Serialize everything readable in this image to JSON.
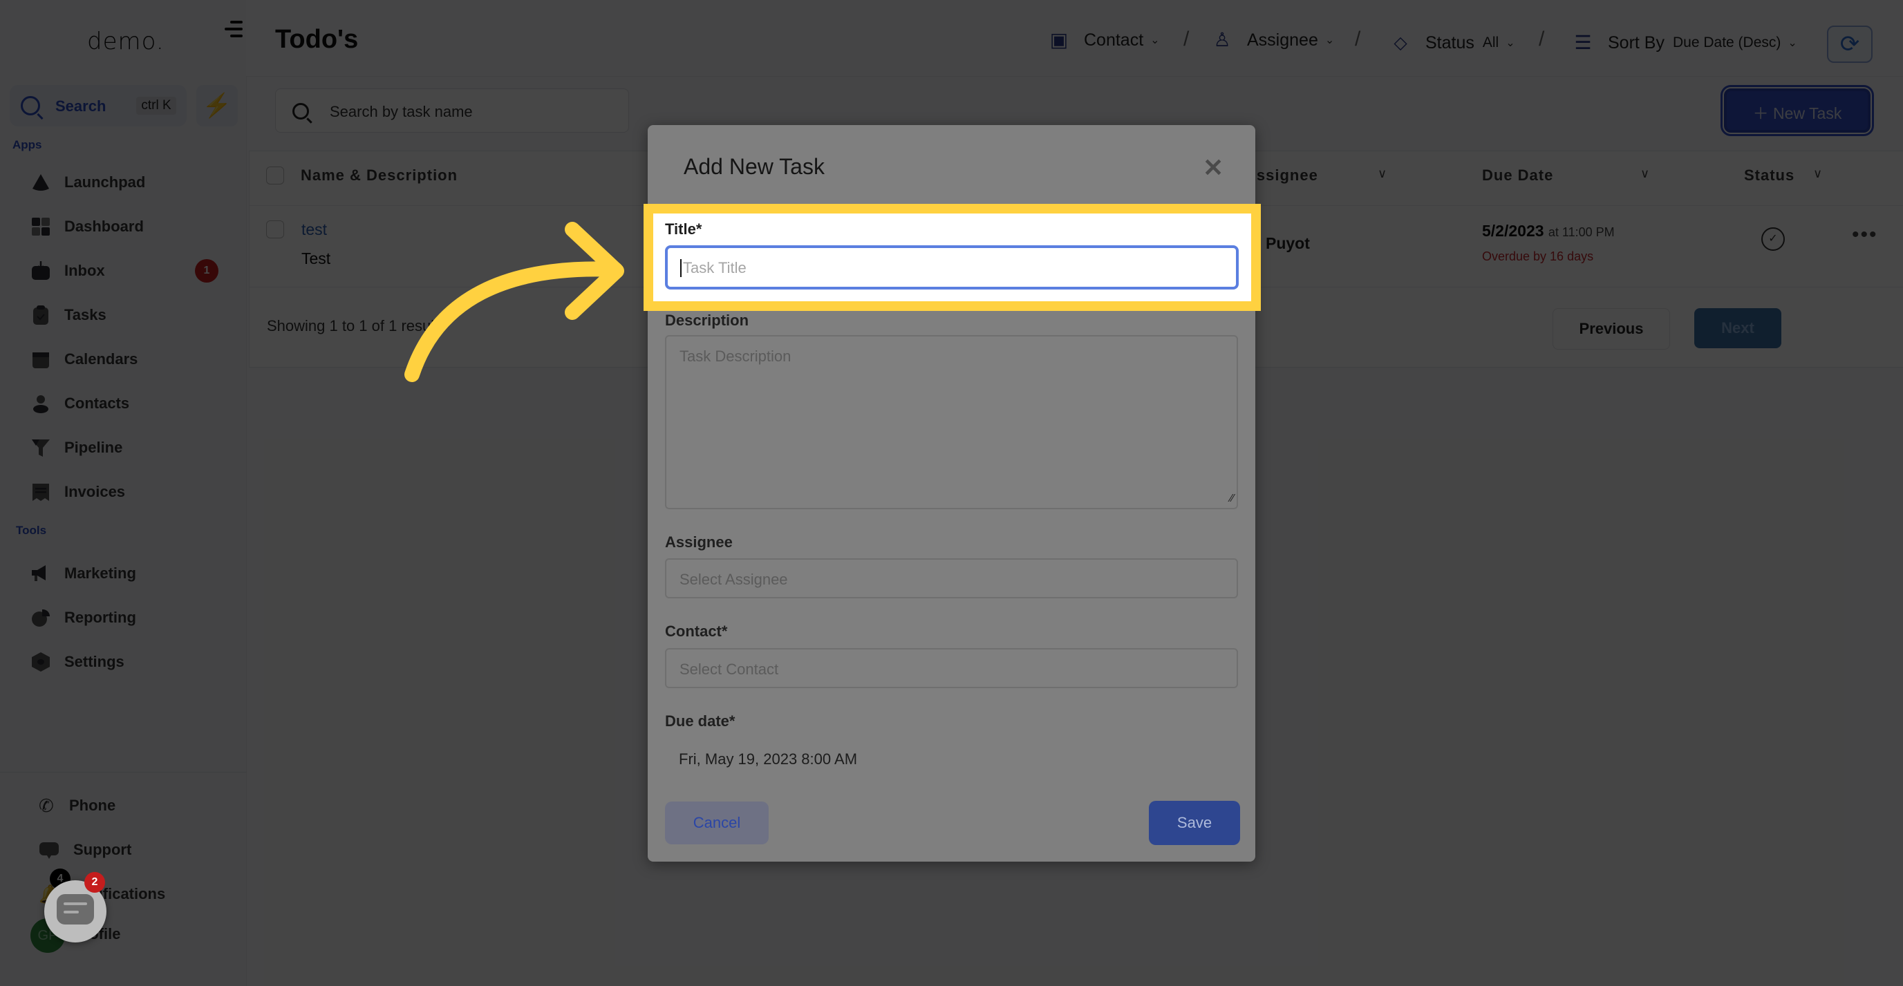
{
  "sidebar": {
    "logo": "demo.",
    "search_label": "Search",
    "search_shortcut": "ctrl K",
    "apps_label": "Apps",
    "tools_label": "Tools",
    "apps": [
      {
        "label": "Launchpad",
        "icon": "rocket-icon"
      },
      {
        "label": "Dashboard",
        "icon": "grid-icon"
      },
      {
        "label": "Inbox",
        "icon": "inbox-icon",
        "badge": "1"
      },
      {
        "label": "Tasks",
        "icon": "clipboard-check-icon"
      },
      {
        "label": "Calendars",
        "icon": "calendar-icon"
      },
      {
        "label": "Contacts",
        "icon": "person-icon"
      },
      {
        "label": "Pipeline",
        "icon": "funnel-icon"
      },
      {
        "label": "Invoices",
        "icon": "receipt-icon"
      }
    ],
    "tools": [
      {
        "label": "Marketing",
        "icon": "megaphone-icon"
      },
      {
        "label": "Reporting",
        "icon": "pie-chart-icon"
      },
      {
        "label": "Settings",
        "icon": "gear-icon"
      }
    ],
    "bottom": [
      {
        "label": "Phone",
        "icon": "phone-icon"
      },
      {
        "label": "Support",
        "icon": "chat-dots-icon"
      },
      {
        "label": "Notifications",
        "icon": "bell-icon",
        "badge": "4"
      },
      {
        "label": "Profile",
        "icon": "avatar",
        "initials": "GP"
      }
    ]
  },
  "header": {
    "title": "Todo's",
    "filters": {
      "contact": "Contact",
      "assignee": "Assignee",
      "status_label": "Status",
      "status_value": "All",
      "sort_label": "Sort By",
      "sort_value": "Due Date (Desc)"
    },
    "separator": "/"
  },
  "main": {
    "search_placeholder": "Search by task name",
    "new_task_label": "New Task",
    "columns": [
      "Name & Description",
      "Assignee",
      "Due Date",
      "Status"
    ],
    "rows": [
      {
        "name": "test",
        "description": "Test",
        "assignee": "Puyot",
        "due_date": "5/2/2023",
        "due_time": "at 11:00 PM",
        "overdue": "Overdue by 16 days"
      }
    ],
    "showing": "Showing 1 to 1 of 1 results",
    "previous_label": "Previous",
    "next_label": "Next"
  },
  "modal": {
    "title": "Add New Task",
    "title_label": "Title*",
    "title_placeholder": "Task Title",
    "description_label": "Description",
    "description_placeholder": "Task Description",
    "assignee_label": "Assignee",
    "assignee_placeholder": "Select Assignee",
    "contact_label": "Contact*",
    "contact_placeholder": "Select Contact",
    "due_label": "Due date*",
    "due_value": "Fri, May 19, 2023 8:00 AM",
    "cancel_label": "Cancel",
    "save_label": "Save"
  },
  "chat_widget": {
    "badge": "2"
  },
  "colors": {
    "accent": "#3251c9",
    "highlight": "#ffd140",
    "overdue": "#c0262b",
    "badge": "#c51d1d"
  }
}
